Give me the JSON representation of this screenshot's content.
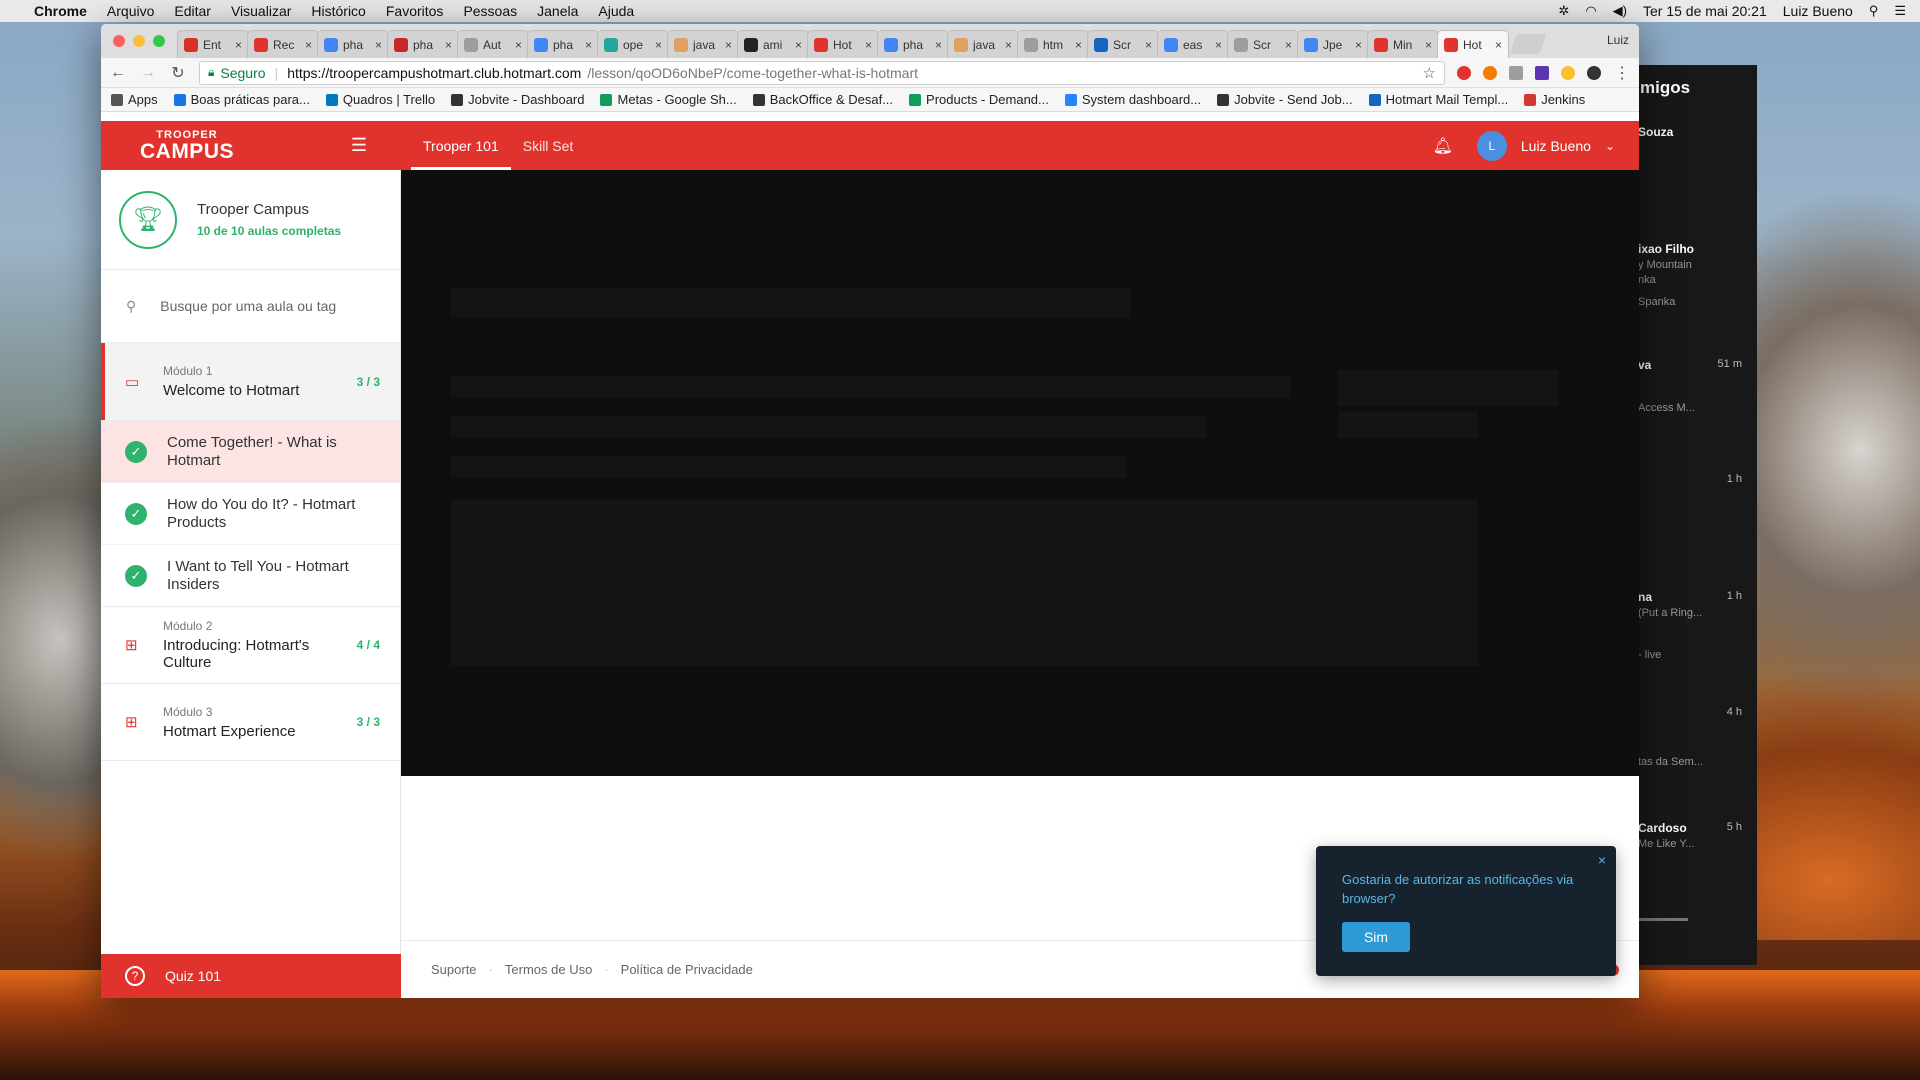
{
  "menubar": {
    "app_name": "Chrome",
    "menus": [
      "Arquivo",
      "Editar",
      "Visualizar",
      "Histórico",
      "Favoritos",
      "Pessoas",
      "Janela",
      "Ajuda"
    ],
    "datetime": "Ter 15 de mai  20:21",
    "user": "Luiz Bueno"
  },
  "browser": {
    "tabs": [
      {
        "label": "Ent",
        "icon": "gmail-icon",
        "color": "#d93025"
      },
      {
        "label": "Rec",
        "icon": "rec-icon",
        "color": "#e1332d"
      },
      {
        "label": "pha",
        "icon": "google-icon",
        "color": "#4285f4"
      },
      {
        "label": "pha",
        "icon": "p-icon",
        "color": "#c62828"
      },
      {
        "label": "Aut",
        "icon": "doc-icon",
        "color": "#9e9e9e"
      },
      {
        "label": "pha",
        "icon": "google-icon",
        "color": "#4285f4"
      },
      {
        "label": "ope",
        "icon": "ope-icon",
        "color": "#26a69a"
      },
      {
        "label": "java",
        "icon": "hand-icon",
        "color": "#e0a062"
      },
      {
        "label": "ami",
        "icon": "github-icon",
        "color": "#222222"
      },
      {
        "label": "Hot",
        "icon": "hotmart-icon",
        "color": "#e1332d"
      },
      {
        "label": "pha",
        "icon": "google-icon",
        "color": "#4285f4"
      },
      {
        "label": "java",
        "icon": "hand-icon",
        "color": "#e0a062"
      },
      {
        "label": "htm",
        "icon": "doc-icon",
        "color": "#9e9e9e"
      },
      {
        "label": "Scr",
        "icon": "w3-icon",
        "color": "#1565c0"
      },
      {
        "label": "eas",
        "icon": "google-icon",
        "color": "#4285f4"
      },
      {
        "label": "Scr",
        "icon": "puzzle-icon",
        "color": "#9e9e9e"
      },
      {
        "label": "Jpe",
        "icon": "google-icon",
        "color": "#4285f4"
      },
      {
        "label": "Min",
        "icon": "hotmart-icon",
        "color": "#e1332d"
      },
      {
        "label": "Hot",
        "icon": "hotmart-icon",
        "color": "#e1332d",
        "active": true
      }
    ],
    "profile": "Luiz",
    "secure_label": "Seguro",
    "url_host": "https://troopercampushotmart.club.hotmart.com",
    "url_path": "/lesson/qoOD6oNbeP/come-together-what-is-hotmart",
    "bookmarks": [
      {
        "label": "Apps",
        "icon": "apps-icon",
        "color": "#555555"
      },
      {
        "label": "Boas práticas para...",
        "icon": "loading-icon",
        "color": "#1a73e8"
      },
      {
        "label": "Quadros | Trello",
        "icon": "trello-icon",
        "color": "#0079bf"
      },
      {
        "label": "Jobvite - Dashboard",
        "icon": "jobvite-icon",
        "color": "#333333"
      },
      {
        "label": "Metas - Google Sh...",
        "icon": "sheets-icon",
        "color": "#0f9d58"
      },
      {
        "label": "BackOffice & Desaf...",
        "icon": "trello-icon",
        "color": "#333333"
      },
      {
        "label": "Products - Demand...",
        "icon": "sheets-icon",
        "color": "#0f9d58"
      },
      {
        "label": "System dashboard...",
        "icon": "jira-icon",
        "color": "#2684ff"
      },
      {
        "label": "Jobvite - Send Job...",
        "icon": "jobvite-icon",
        "color": "#333333"
      },
      {
        "label": "Hotmart Mail Templ...",
        "icon": "tx-icon",
        "color": "#1565c0"
      },
      {
        "label": "Jenkins",
        "icon": "jenkins-icon",
        "color": "#d33833"
      }
    ]
  },
  "app": {
    "logo_top": "TROOPER",
    "logo_bottom": "CAMPUS",
    "nav_tabs": [
      "Trooper 101",
      "Skill Set"
    ],
    "user_initial": "L",
    "user_name": "Luiz Bueno",
    "brand_color": "#e1332d",
    "success_color": "#2db36b"
  },
  "sidebar": {
    "course_title": "Trooper Campus",
    "course_progress": "10 de 10 aulas completas",
    "search_placeholder": "Busque por uma aula ou tag",
    "modules": [
      {
        "number": "Módulo 1",
        "name": "Welcome to Hotmart",
        "count": "3 / 3",
        "open": true,
        "lessons": [
          {
            "title": "Come Together! - What is Hotmart",
            "current": true
          },
          {
            "title": "How do You do It? - Hotmart Products"
          },
          {
            "title": "I Want to Tell You - Hotmart Insiders"
          }
        ]
      },
      {
        "number": "Módulo 2",
        "name": "Introducing: Hotmart's Culture",
        "count": "4 / 4"
      },
      {
        "number": "Módulo 3",
        "name": "Hotmart Experience",
        "count": "3 / 3"
      }
    ],
    "quiz_label": "Quiz 101"
  },
  "footer": {
    "links": [
      "Suporte",
      "Termos de Uso",
      "Política de Privacidade"
    ]
  },
  "notification": {
    "text": "Gostaria de autorizar as notificações via browser?",
    "button": "Sim",
    "close": "×"
  },
  "background_panel": {
    "title": "migos",
    "entries": [
      {
        "name": "Souza",
        "line1": "",
        "line2": "",
        "time": ""
      },
      {
        "name": "ixao Filho",
        "line1": "y Mountain",
        "line2": "nka",
        "line3": "Spanka",
        "time": ""
      },
      {
        "name": "va",
        "line1": "",
        "line2": "Access M...",
        "time": "51 m"
      },
      {
        "name": "",
        "line1": "",
        "line2": "",
        "time": "1 h"
      },
      {
        "name": "na",
        "line1": "(Put a Ring...",
        "line2": "- live",
        "time": "1 h"
      },
      {
        "name": "",
        "line1": "",
        "line2": "tas da Sem...",
        "time": "4 h"
      },
      {
        "name": "Cardoso",
        "line1": "Me Like Y...",
        "line2": "",
        "time": "5 h"
      }
    ]
  }
}
